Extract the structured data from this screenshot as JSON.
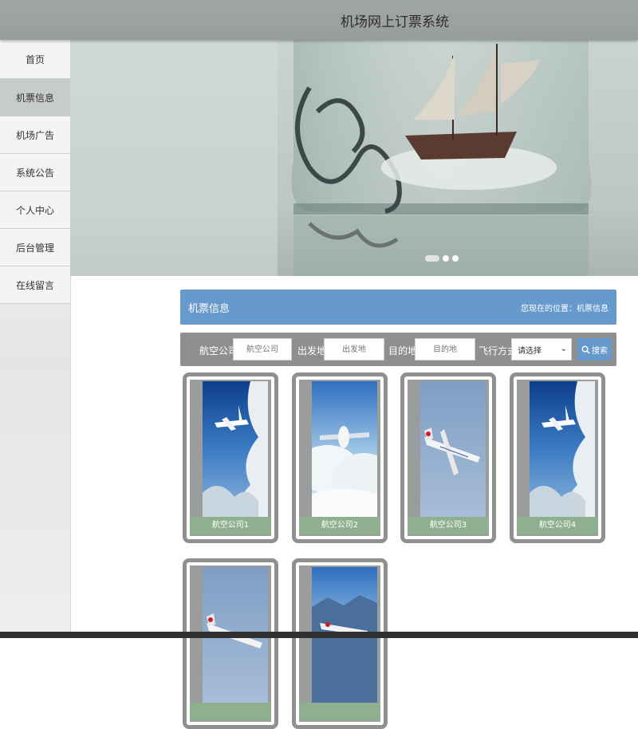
{
  "header": {
    "title": "机场网上订票系统"
  },
  "sidebar": {
    "items": [
      {
        "label": "首页"
      },
      {
        "label": "机票信息"
      },
      {
        "label": "机场广告"
      },
      {
        "label": "系统公告"
      },
      {
        "label": "个人中心"
      },
      {
        "label": "后台管理"
      },
      {
        "label": "在线留言"
      }
    ],
    "active_index": 1
  },
  "banner": {
    "slide_count": 3,
    "active_slide": 0
  },
  "section": {
    "title": "机票信息",
    "breadcrumb": "您现在的位置：机票信息"
  },
  "search": {
    "airline_label": "航空公司",
    "airline_placeholder": "航空公司",
    "departure_label": "出发地",
    "departure_placeholder": "出发地",
    "destination_label": "目的地",
    "destination_placeholder": "目的地",
    "flight_type_label": "飞行方式",
    "flight_type_value": "请选择",
    "button_label": "搜索"
  },
  "cards": [
    {
      "caption": "航空公司1",
      "image": "plane-over-clouds"
    },
    {
      "caption": "航空公司2",
      "image": "plane-above-clouds"
    },
    {
      "caption": "航空公司3",
      "image": "air-china-plane"
    },
    {
      "caption": "航空公司4",
      "image": "plane-over-clouds"
    },
    {
      "caption": "",
      "image": "air-china-plane"
    },
    {
      "caption": "",
      "image": "plane-mountains"
    }
  ],
  "colors": {
    "header_bg": "#a0a3a3",
    "accent_blue": "#6699cc",
    "card_border": "#8e918f",
    "caption_bg": "#8fb08f"
  }
}
